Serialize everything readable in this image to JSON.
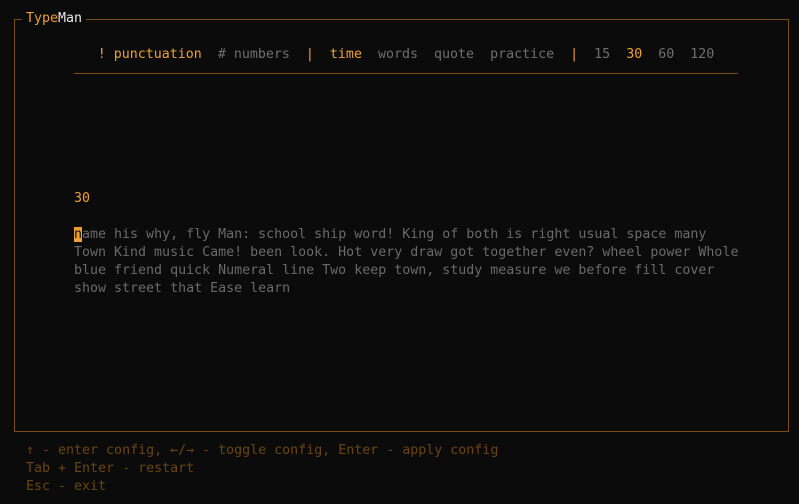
{
  "window": {
    "title_part1": "Type",
    "title_part2": "Man"
  },
  "config": {
    "punctuation": "! punctuation",
    "numbers": "# numbers",
    "sep1": "|",
    "time": "time",
    "words": "words",
    "quote": "quote",
    "practice": "practice",
    "sep2": "|",
    "t15": "15",
    "t30": "30",
    "t60": "60",
    "t120": "120"
  },
  "test": {
    "timer": "30",
    "cursor_char": "n",
    "line1_rest": "ame his why, fly Man: school ship word! King of both is right usual space many",
    "line2": "Town Kind music Came! been look. Hot very draw got together even? wheel power Whole",
    "line3": "blue friend quick Numeral line Two keep town, study measure we before fill cover",
    "line4": "show street that Ease learn"
  },
  "help": {
    "line1": "↑ - enter config, ←/→ - toggle config, Enter - apply config",
    "line2": "Tab + Enter - restart",
    "line3": "Esc - exit"
  },
  "colors": {
    "accent": "#f0a030",
    "muted": "#6f6f6f",
    "border": "#7a4e12",
    "background": "#0b0b0b"
  }
}
